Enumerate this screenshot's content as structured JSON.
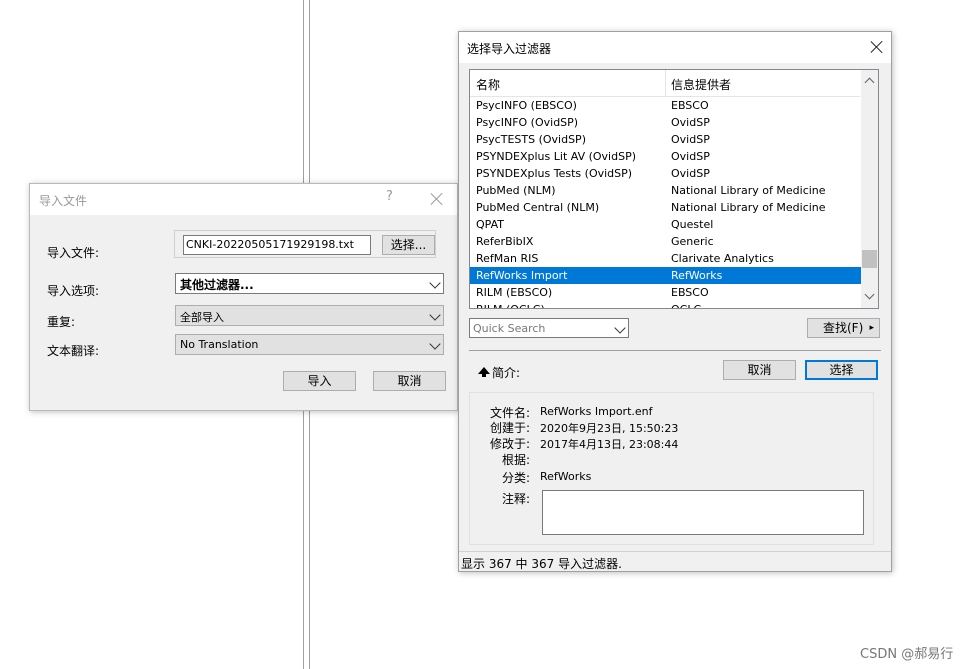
{
  "import_dialog": {
    "title": "导入文件",
    "help_label": "?",
    "file_label": "导入文件:",
    "file_value": "CNKI-20220505171929198.txt",
    "choose_label": "选择...",
    "options_label": "导入选项:",
    "options_value": "其他过滤器...",
    "duplicates_label": "重复:",
    "duplicates_value": "全部导入",
    "translation_label": "文本翻译:",
    "translation_value": "No Translation",
    "import_button": "导入",
    "cancel_button": "取消"
  },
  "filter_dialog": {
    "title": "选择导入过滤器",
    "columns": [
      "名称",
      "信息提供者"
    ],
    "rows": [
      {
        "name": "PsycINFO (EBSCO)",
        "provider": "EBSCO"
      },
      {
        "name": "PsycINFO (OvidSP)",
        "provider": "OvidSP"
      },
      {
        "name": "PsycTESTS (OvidSP)",
        "provider": "OvidSP"
      },
      {
        "name": "PSYNDEXplus Lit AV (OvidSP)",
        "provider": "OvidSP"
      },
      {
        "name": "PSYNDEXplus Tests (OvidSP)",
        "provider": "OvidSP"
      },
      {
        "name": "PubMed (NLM)",
        "provider": "National Library of Medicine"
      },
      {
        "name": "PubMed Central (NLM)",
        "provider": "National Library of Medicine"
      },
      {
        "name": "QPAT",
        "provider": "Questel"
      },
      {
        "name": "ReferBibIX",
        "provider": "Generic"
      },
      {
        "name": "RefMan RIS",
        "provider": "Clarivate Analytics"
      },
      {
        "name": "RefWorks Import",
        "provider": "RefWorks"
      },
      {
        "name": "RILM (EBSCO)",
        "provider": "EBSCO"
      },
      {
        "name": "RILM (OCLC)",
        "provider": "OCLC"
      }
    ],
    "selected_index": 10,
    "quick_search_placeholder": "Quick Search",
    "find_button": "查找(F)",
    "find_arrow": "▸",
    "summary_label": "简介:",
    "cancel_button": "取消",
    "select_button": "选择",
    "details": {
      "filename_label": "文件名:",
      "filename_value": "RefWorks Import.enf",
      "created_label": "创建于:",
      "created_value": "2020年9月23日, 15:50:23",
      "modified_label": "修改于:",
      "modified_value": "2017年4月13日, 23:08:44",
      "based_on_label": "根据:",
      "category_label": "分类:",
      "category_value": "RefWorks",
      "notes_label": "注释:"
    },
    "status_text": "显示 367 中 367 导入过滤器."
  },
  "watermark": "CSDN @郝易行",
  "colors": {
    "selection": "#0078d7",
    "button_focus": "#0078d7"
  }
}
